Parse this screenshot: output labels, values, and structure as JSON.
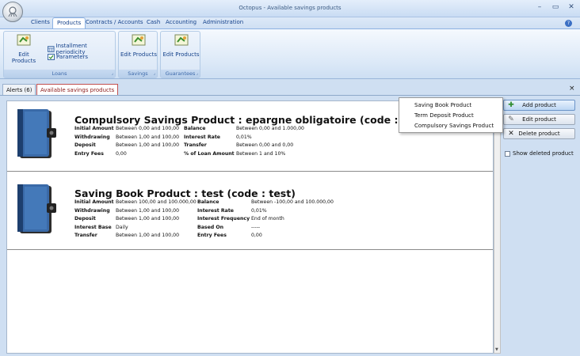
{
  "window": {
    "title": "Octopus - Available savings products",
    "controls": [
      "–",
      "▭",
      "✕"
    ]
  },
  "menu": {
    "tabs": [
      "Clients",
      "Products",
      "Contracts / Accounts",
      "Cash",
      "Accounting",
      "Administration"
    ],
    "active": "Products",
    "help": "?"
  },
  "ribbon": {
    "loans": {
      "label": "Loans",
      "edit_products": "Edit Products",
      "installment_periodicity": "Installment periodicity",
      "parameters": "Parameters"
    },
    "savings": {
      "label": "Savings",
      "edit_products": "Edit Products"
    },
    "guarantees": {
      "label": "Guarantees",
      "edit_products": "Edit Products"
    }
  },
  "tabs": {
    "alerts": "Alerts (6)",
    "available": "Available savings products",
    "close": "×"
  },
  "products": [
    {
      "title": "Compulsory Savings Product : epargne obligatoire (code : eo)",
      "left": [
        {
          "k": "Initial Amount",
          "v": "Between 0,00 and 100,00"
        },
        {
          "k": "Withdrawing",
          "v": "Between 1,00 and 100,00"
        },
        {
          "k": "Deposit",
          "v": "Between 1,00 and 100,00"
        },
        {
          "k": "Entry Fees",
          "v": "0,00"
        }
      ],
      "right": [
        {
          "k": "Balance",
          "v": "Between 0,00 and 1.000,00"
        },
        {
          "k": "Interest Rate",
          "v": "0,01%"
        },
        {
          "k": "Transfer",
          "v": "Between 0,00 and 0,00"
        },
        {
          "k": "% of Loan Amount",
          "v": "Between 1 and 10%"
        }
      ]
    },
    {
      "title": "Saving Book Product : test (code : test)",
      "left": [
        {
          "k": "Initial Amount",
          "v": "Between 100,00 and 100.000,00"
        },
        {
          "k": "Withdrawing",
          "v": "Between 1,00 and 100,00"
        },
        {
          "k": "Deposit",
          "v": "Between 1,00 and 100,00"
        },
        {
          "k": "Interest Base",
          "v": "Daily"
        },
        {
          "k": "Transfer",
          "v": "Between 1,00 and 100,00"
        }
      ],
      "right": [
        {
          "k": "Balance",
          "v": "Between -100,00 and 100.000,00"
        },
        {
          "k": "Interest Rate",
          "v": "0,01%"
        },
        {
          "k": "Interest Frequency",
          "v": "End of month"
        },
        {
          "k": "Based On",
          "v": "-----"
        },
        {
          "k": "Entry Fees",
          "v": "0,00"
        }
      ]
    }
  ],
  "actions": {
    "add": "Add product",
    "edit": "Edit product",
    "delete": "Delete product",
    "show_deleted": "Show deleted product"
  },
  "dropdown": [
    "Saving Book Product",
    "Term Deposit Product",
    "Compulsory Savings Product"
  ]
}
